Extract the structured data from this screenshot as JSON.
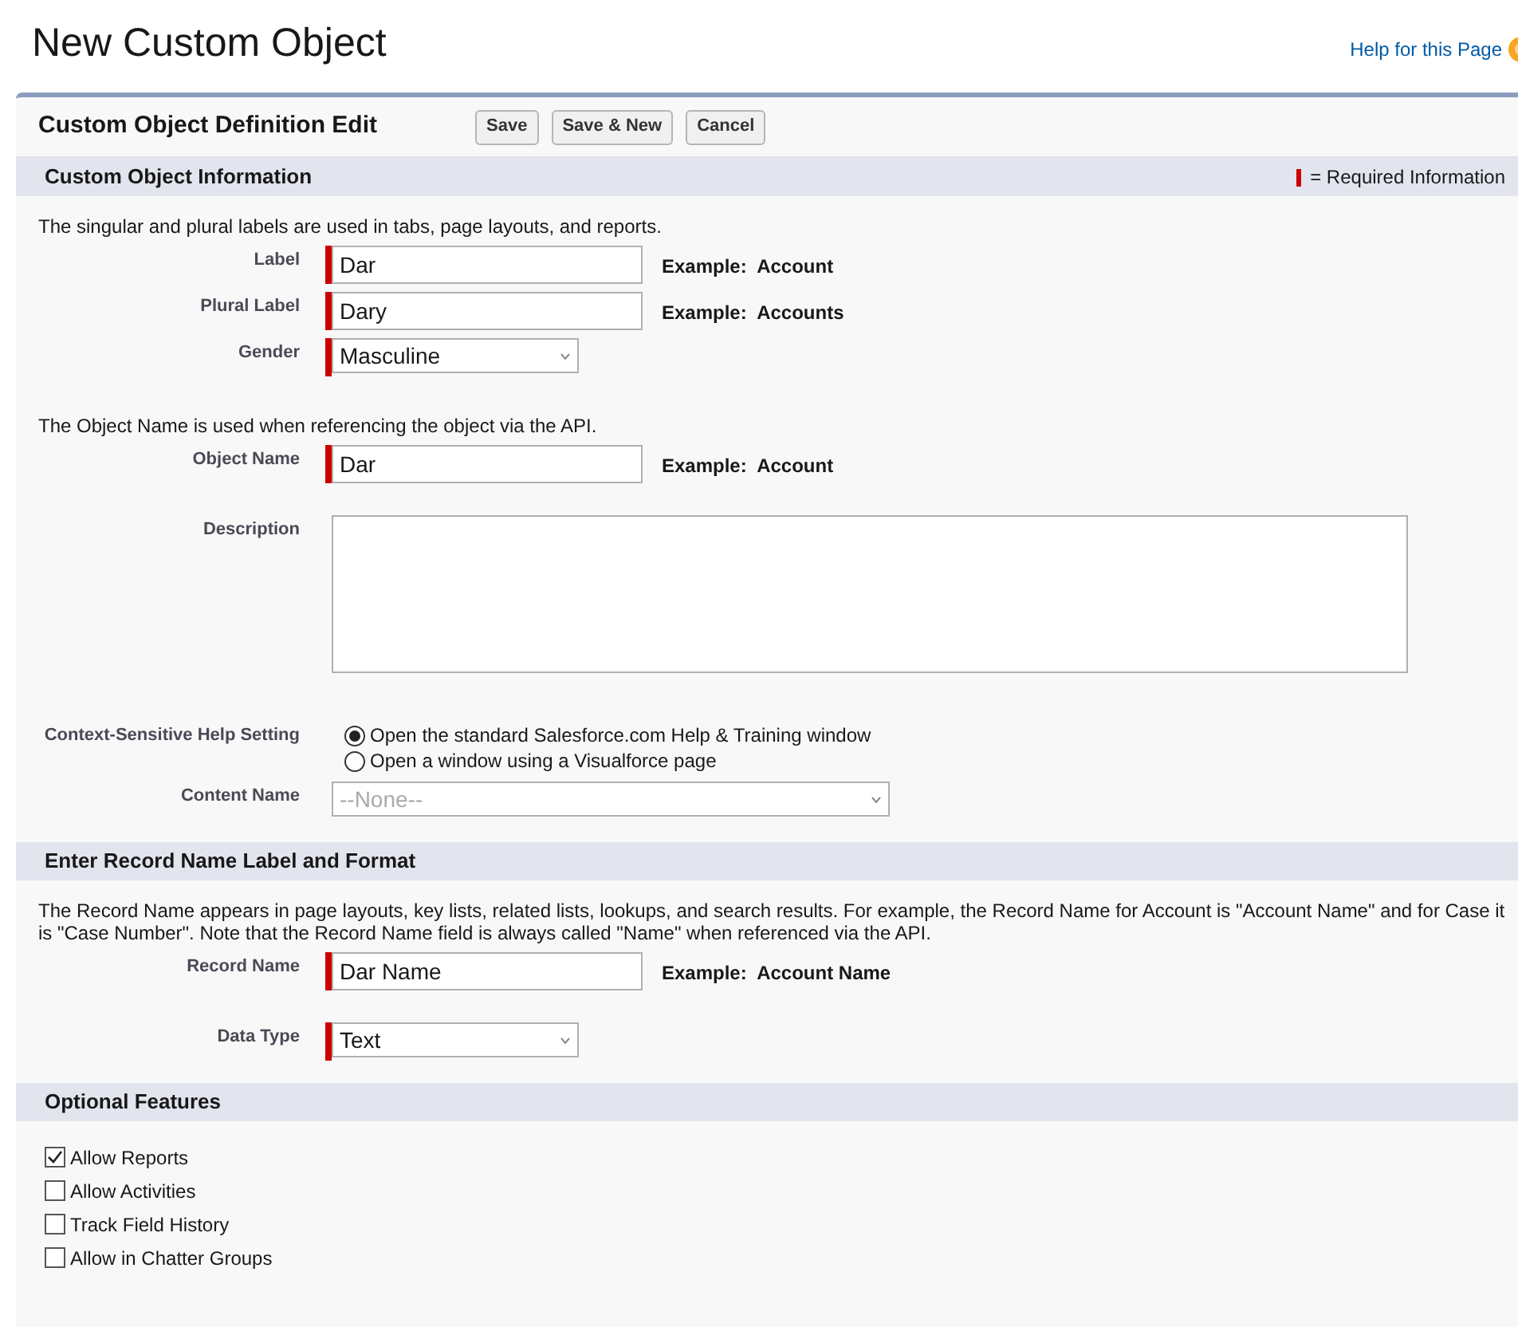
{
  "page_title": "New Custom Object",
  "help_link": "Help for this Page",
  "panel": {
    "title": "Custom Object Definition Edit",
    "buttons": [
      "Save",
      "Save & New",
      "Cancel"
    ]
  },
  "required_legend": "= Required Information",
  "sections": [
    {
      "title": "Custom Object Information",
      "items": [
        {
          "kind": "note",
          "text": "The singular and plural labels are used in tabs, page layouts, and reports."
        },
        {
          "kind": "text",
          "label": "Label",
          "value": "Dar",
          "required": true,
          "example": "Example:  Account"
        },
        {
          "kind": "text",
          "label": "Plural Label",
          "value": "Dary",
          "required": true,
          "example": "Example:  Accounts"
        },
        {
          "kind": "select",
          "label": "Gender",
          "value": "Masculine",
          "required": true,
          "disabled": false
        },
        {
          "kind": "note",
          "text": "The Object Name is used when referencing the object via the API."
        },
        {
          "kind": "text",
          "label": "Object Name",
          "value": "Dar",
          "required": true,
          "example": "Example:  Account"
        },
        {
          "kind": "textarea",
          "label": "Description"
        },
        {
          "kind": "radio",
          "label": "Context-Sensitive Help Setting",
          "options": [
            {
              "label": "Open the standard Salesforce.com Help & Training window",
              "selected": true
            },
            {
              "label": "Open a window using a Visualforce page",
              "selected": false
            }
          ]
        },
        {
          "kind": "select",
          "label": "Content Name",
          "value": "--None--",
          "required": false,
          "disabled": true
        }
      ]
    },
    {
      "title": "Enter Record Name Label and Format",
      "items": [
        {
          "kind": "note",
          "text": "The Record Name appears in page layouts, key lists, related lists, lookups, and search results. For example, the Record Name for Account is \"Account Name\" and for Case it is \"Case Number\". Note that the Record Name field is always called \"Name\" when referenced via the API."
        },
        {
          "kind": "text",
          "label": "Record Name",
          "value": "Dar Name",
          "required": true,
          "example": "Example:  Account Name"
        },
        {
          "kind": "select",
          "label": "Data Type",
          "value": "Text",
          "required": true,
          "disabled": false
        }
      ]
    },
    {
      "title": "Optional Features",
      "items": [
        {
          "kind": "checkbox",
          "label": "Allow Reports",
          "checked": true
        },
        {
          "kind": "checkbox",
          "label": "Allow Activities",
          "checked": false
        },
        {
          "kind": "checkbox",
          "label": "Track Field History",
          "checked": false
        },
        {
          "kind": "checkbox",
          "label": "Allow in Chatter Groups",
          "checked": false
        }
      ]
    }
  ]
}
